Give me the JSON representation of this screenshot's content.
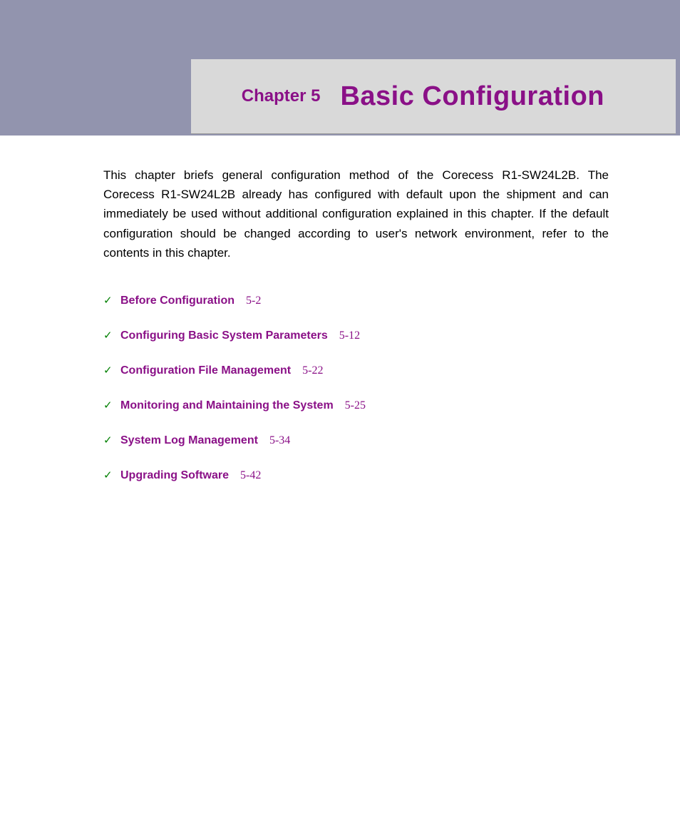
{
  "header": {
    "chapter_label": "Chapter 5",
    "chapter_title": "Basic Configuration"
  },
  "intro": "This chapter briefs general configuration method of the Corecess R1-SW24L2B. The Corecess R1-SW24L2B already has configured with default upon the shipment and can immediately be used without additional configuration explained in this chapter. If the default configuration should be changed according to user's network environment, refer to the contents in this chapter.",
  "toc": [
    {
      "label": "Before Configuration",
      "page": "5-2"
    },
    {
      "label": "Configuring Basic System Parameters",
      "page": "5-12"
    },
    {
      "label": "Configuration File Management",
      "page": "5-22"
    },
    {
      "label": "Monitoring and Maintaining the System",
      "page": "5-25"
    },
    {
      "label": "System Log Management",
      "page": "5-34"
    },
    {
      "label": "Upgrading Software",
      "page": "5-42"
    }
  ]
}
